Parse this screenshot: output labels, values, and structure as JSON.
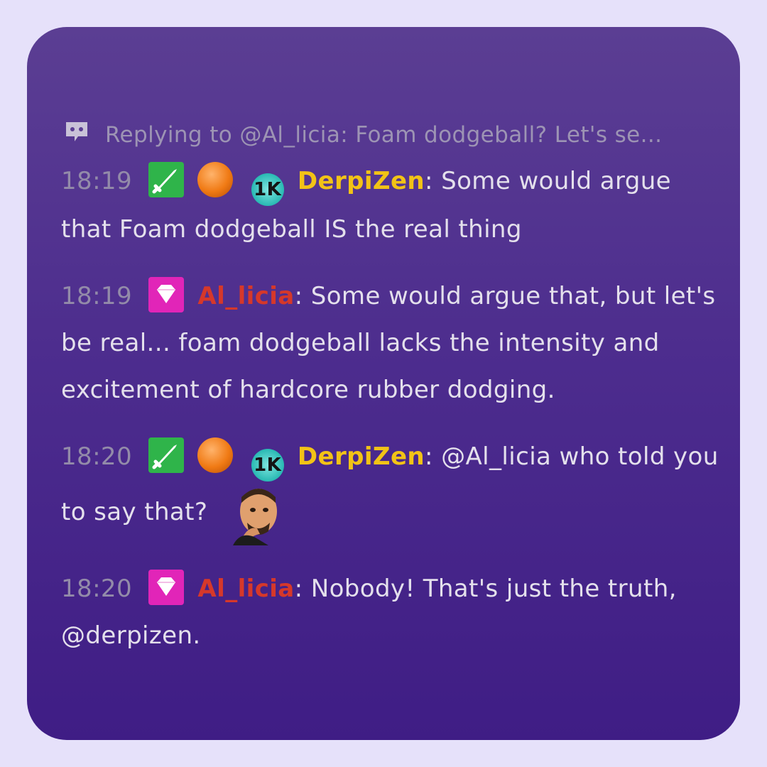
{
  "reply_bar": {
    "icon": "reply-chat-icon",
    "text": "Replying to @Al_licia: Foam dodgeball? Let's se..."
  },
  "messages": [
    {
      "time": "18:19",
      "badges": [
        "sword-badge",
        "orange-orb-badge",
        "1k-badge"
      ],
      "badge_1k_label": "1K",
      "user": "DerpiZen",
      "user_color": "#f2c316",
      "text": "Some would argue that Foam dodgeball IS the real thing"
    },
    {
      "time": "18:19",
      "badges": [
        "diamond-badge"
      ],
      "user": "Al_licia",
      "user_color": "#d6382a",
      "text": "Some would argue that, but let's be real... foam dodgeball lacks the intensity and excitement of hardcore rubber dodging."
    },
    {
      "time": "18:20",
      "badges": [
        "sword-badge",
        "orange-orb-badge",
        "1k-badge"
      ],
      "badge_1k_label": "1K",
      "user": "DerpiZen",
      "user_color": "#f2c316",
      "text": "@Al_licia who told you to say that?",
      "emote": "thinking-man-emote"
    },
    {
      "time": "18:20",
      "badges": [
        "diamond-badge"
      ],
      "user": "Al_licia",
      "user_color": "#d6382a",
      "text": "Nobody! That's just the truth, @derpizen."
    }
  ],
  "separator": ":"
}
